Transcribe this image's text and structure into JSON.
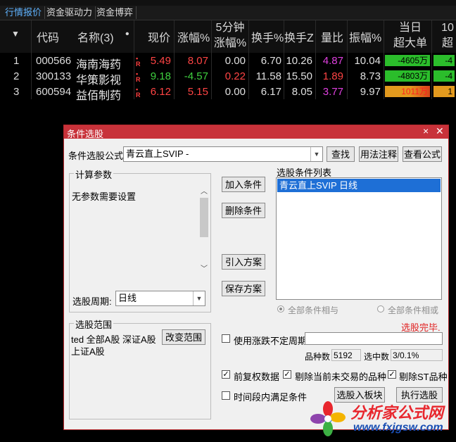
{
  "tabs": [
    "行情报价",
    "资金驱动力",
    "资金博弈"
  ],
  "header": {
    "sort_icon": "▼",
    "code": "代码",
    "name": "名称(3)",
    "dot": "•",
    "price": "现价",
    "change_pct": "涨幅%",
    "five_min": [
      "5分钟",
      "涨幅%"
    ],
    "turnover": "换手%",
    "turnover_z": "换手Z",
    "volume_ratio": "量比",
    "amplitude": "振幅%",
    "today_big": [
      "当日",
      "超大单"
    ],
    "extra": [
      "10",
      "超"
    ]
  },
  "rows": [
    {
      "idx": "1",
      "code": "000566",
      "name": "海南海药",
      "price": "5.49",
      "chg": "8.07",
      "five": "0.00",
      "turn": "6.70",
      "turnz": "10.26",
      "vr": "4.87",
      "amp": "10.04",
      "big": "-4605万",
      "extra": "-4"
    },
    {
      "idx": "2",
      "code": "300133",
      "name": "华策影视",
      "price": "9.18",
      "chg": "-4.57",
      "five": "0.22",
      "turn": "11.58",
      "turnz": "15.50",
      "vr": "1.89",
      "amp": "8.73",
      "big": "-4803万",
      "extra": "-4"
    },
    {
      "idx": "3",
      "code": "600594",
      "name": "益佰制药",
      "price": "6.12",
      "chg": "5.15",
      "five": "0.00",
      "turn": "6.17",
      "turnz": "8.05",
      "vr": "3.77",
      "amp": "9.97",
      "big": "1011万",
      "extra": "1"
    }
  ],
  "dialog": {
    "title": "条件选股",
    "formula_label": "条件选股公式",
    "formula_value": "青云直上SVIP -",
    "find_btn": "查找",
    "usage_btn": "用法注释",
    "view_btn": "查看公式",
    "params_group": "计算参数",
    "no_params": "无参数需要设置",
    "period_label": "选股周期:",
    "period_value": "日线",
    "add_btn": "加入条件",
    "del_btn": "删除条件",
    "import_btn": "引入方案",
    "save_btn": "保存方案",
    "list_label": "选股条件列表",
    "list_items": [
      "青云直上SVIP  日线"
    ],
    "radio_and": "全部条件相与",
    "radio_or": "全部条件相或",
    "status": "选股完毕.",
    "scope_group": "选股范围",
    "scope_text": [
      "ted 全部A股 深证A股",
      "上证A股"
    ],
    "scope_btn": "改变范围",
    "use_period_label": "使用涨跌不定周期",
    "species_label": "品种数",
    "species_value": "5192",
    "selected_label": "选中数",
    "selected_value": "3/0.1%",
    "fq_label": "前复权数据",
    "fq_checked": true,
    "exclude_label": "剔除当前未交易的品种",
    "exclude_checked": true,
    "st_label": "剔除ST品种",
    "st_checked": true,
    "time_label": "时间段内满足条件",
    "time_checked": false,
    "to_block_btn": "选股入板块",
    "run_btn": "执行选股"
  },
  "logo": {
    "title": "分析家公式网",
    "url": "www.fxjgsw.com"
  },
  "colors": {
    "up": "#ff4444",
    "down": "#3fd03f",
    "accent_title": "#c8323a",
    "list_select": "#1e6fd6"
  }
}
